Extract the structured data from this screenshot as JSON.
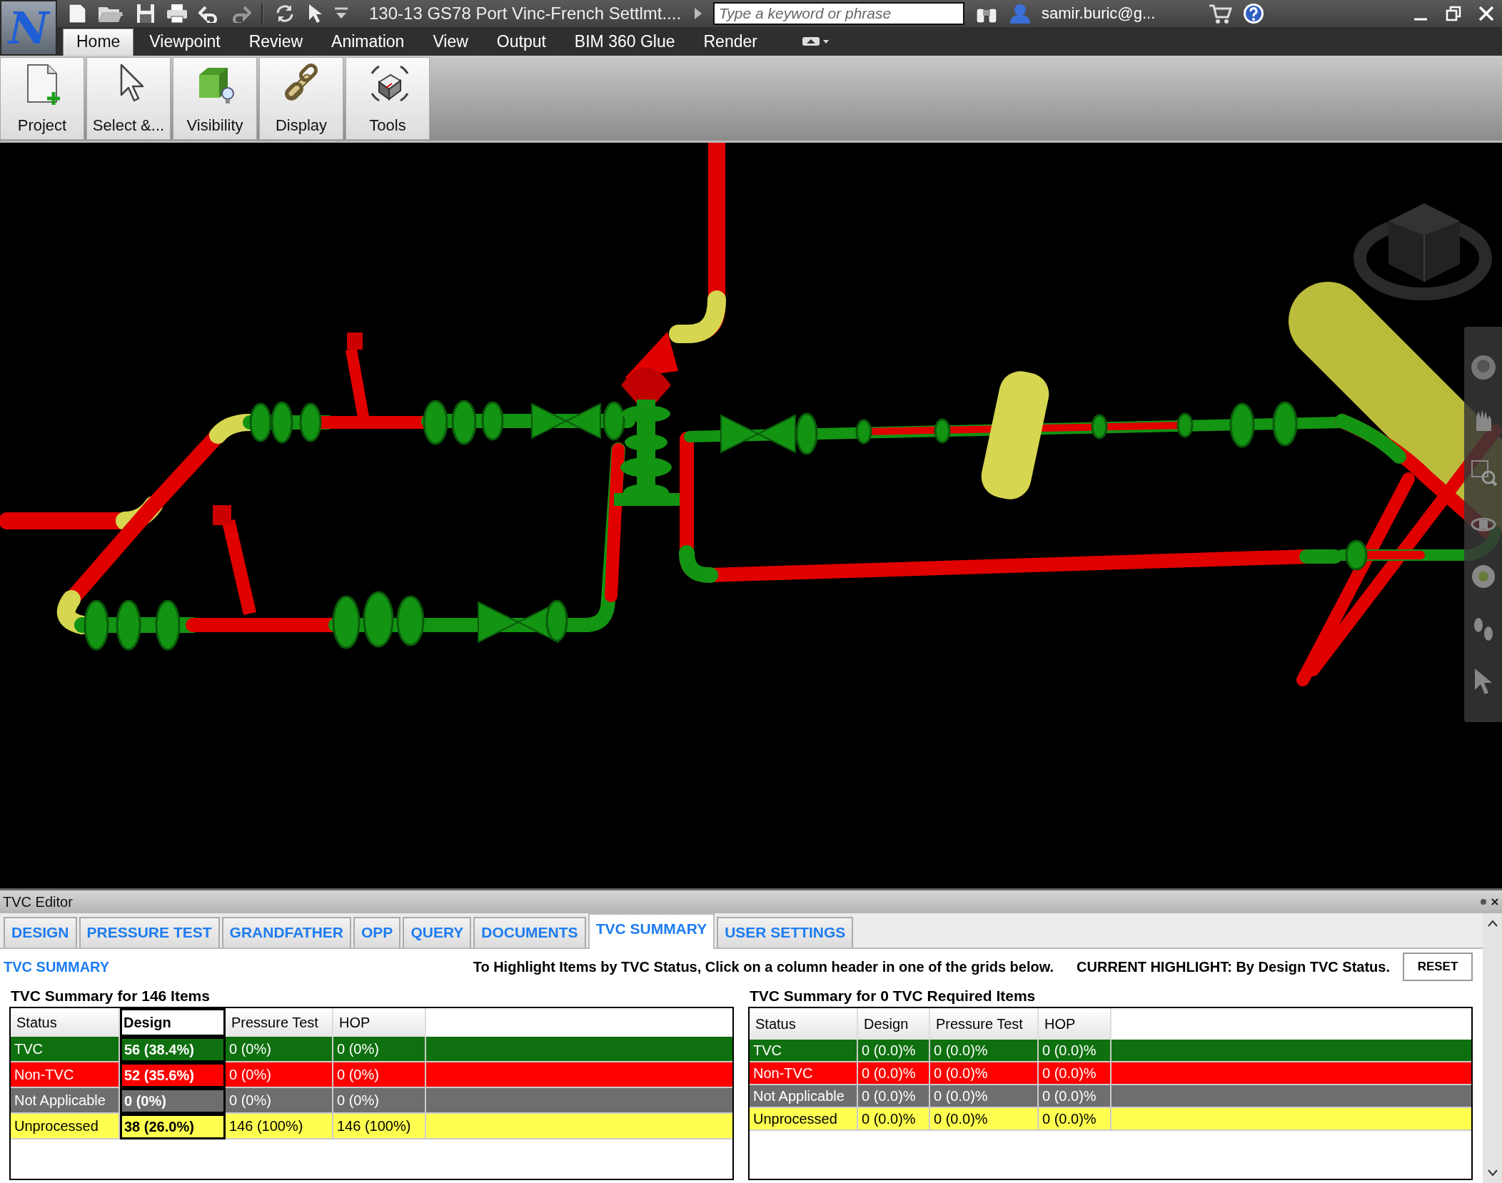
{
  "app_button": {
    "logo": "N"
  },
  "title_bar": {
    "title": "130-13 GS78 Port Vinc-French Settlmt....",
    "search": {
      "placeholder": "Type a keyword or phrase"
    },
    "user": "samir.buric@g..."
  },
  "ribbon_tabs": [
    {
      "label": "Home",
      "selected": true
    },
    {
      "label": "Viewpoint",
      "selected": false
    },
    {
      "label": "Review",
      "selected": false
    },
    {
      "label": "Animation",
      "selected": false
    },
    {
      "label": "View",
      "selected": false
    },
    {
      "label": "Output",
      "selected": false
    },
    {
      "label": "BIM 360 Glue",
      "selected": false
    },
    {
      "label": "Render",
      "selected": false
    }
  ],
  "ribbon_buttons": [
    {
      "label": "Project",
      "kind": "project"
    },
    {
      "label": "Select &...",
      "kind": "select"
    },
    {
      "label": "Visibility",
      "kind": "visibility"
    },
    {
      "label": "Display",
      "kind": "display"
    },
    {
      "label": "Tools",
      "kind": "tools"
    }
  ],
  "panel": {
    "title": "TVC Editor",
    "tabs": [
      {
        "label": "DESIGN",
        "selected": false
      },
      {
        "label": "PRESSURE TEST",
        "selected": false
      },
      {
        "label": "GRANDFATHER",
        "selected": false
      },
      {
        "label": "OPP",
        "selected": false
      },
      {
        "label": "QUERY",
        "selected": false
      },
      {
        "label": "DOCUMENTS",
        "selected": false
      },
      {
        "label": "TVC SUMMARY",
        "selected": true
      },
      {
        "label": "USER SETTINGS",
        "selected": false
      }
    ],
    "heading": "TVC SUMMARY",
    "instruction": "To Highlight Items by TVC Status, Click on a column header in one of the grids below.",
    "current_highlight": "CURRENT HIGHLIGHT: By Design TVC Status.",
    "reset_button": "RESET",
    "grids": [
      {
        "title": "TVC Summary for 146 Items",
        "columns": [
          {
            "label": "Status",
            "selected": false
          },
          {
            "label": "Design",
            "selected": true
          },
          {
            "label": "Pressure Test",
            "selected": false
          },
          {
            "label": "HOP",
            "selected": false
          }
        ],
        "rows": [
          {
            "color": "#0f700f",
            "cells": [
              "TVC",
              "56 (38.4%)",
              "0 (0%)",
              "0 (0%)"
            ]
          },
          {
            "color": "#ff0000",
            "cells": [
              "Non-TVC",
              "52 (35.6%)",
              "0 (0%)",
              "0 (0%)"
            ]
          },
          {
            "color": "#6e6e6e",
            "cells": [
              "Not Applicable",
              "0 (0%)",
              "0 (0%)",
              "0 (0%)"
            ]
          },
          {
            "color": "#ffff50",
            "cells": [
              "Unprocessed",
              "38 (26.0%)",
              "146 (100%)",
              "146 (100%)"
            ]
          }
        ]
      },
      {
        "title": "TVC Summary for 0 TVC Required Items",
        "columns": [
          {
            "label": "Status",
            "selected": false
          },
          {
            "label": "Design",
            "selected": false
          },
          {
            "label": "Pressure Test",
            "selected": false
          },
          {
            "label": "HOP",
            "selected": false
          }
        ],
        "rows": [
          {
            "color": "#0f700f",
            "cells": [
              "TVC",
              "0 (0.0)%",
              "0 (0.0)%",
              "0 (0.0)%"
            ]
          },
          {
            "color": "#ff0000",
            "cells": [
              "Non-TVC",
              "0 (0.0)%",
              "0 (0.0)%",
              "0 (0.0)%"
            ]
          },
          {
            "color": "#6e6e6e",
            "cells": [
              "Not Applicable",
              "0 (0.0)%",
              "0 (0.0)%",
              "0 (0.0)%"
            ]
          },
          {
            "color": "#ffff50",
            "cells": [
              "Unprocessed",
              "0 (0.0)%",
              "0 (0.0)%",
              "0 (0.0)%"
            ]
          }
        ]
      }
    ]
  }
}
